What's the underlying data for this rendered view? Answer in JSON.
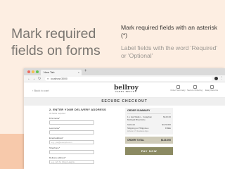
{
  "slide": {
    "headline": "Mark required fields on forms",
    "tip_required": "Mark required fields with an asterisk (*)",
    "tip_label": "Label fields with the word 'Required' or 'Optional'"
  },
  "browser": {
    "tab_title": "New Tab",
    "tab_close": "×",
    "new_tab": "+",
    "url": "localhost:3000/",
    "back": "←",
    "forward": "→",
    "reload": "↻",
    "menu": "⋮"
  },
  "site": {
    "back_link": "‹  Back to cart",
    "logo": "bellroy",
    "logo_sub": "CARRY BETTER",
    "header_items": [
      "Order Summary",
      "Secure Ordering",
      "Easy Returns"
    ],
    "page_title": "SECURE CHECKOUT"
  },
  "form": {
    "heading": "2. ENTER YOUR DELIVERY ADDRESS",
    "note": "All fields required",
    "fields": [
      {
        "label": "First name*",
        "placeholder": ""
      },
      {
        "label": "Last name*",
        "placeholder": ""
      },
      {
        "label": "Email address*",
        "placeholder": "e.g. you@example.com"
      },
      {
        "label": "Telephone*",
        "placeholder": ""
      },
      {
        "label": "Delivery address*",
        "placeholder": "e.g. 123 St. (Brgy) Heights"
      }
    ]
  },
  "summary": {
    "title": "ORDER SUMMARY",
    "item_name": "1 x Hat Wallet – Caraghan Midnight Blue/Ashe",
    "item_price": "$123.00",
    "subtotal_label": "Subtotal",
    "subtotal_value": "$123.000",
    "shipping_label": "Shipping to Philippines",
    "shipping_note": "Arrives in 5 business days",
    "shipping_value": "FREE",
    "total_label": "ORDER TOTAL",
    "total_value": "$123.000",
    "pay_button": "PAY NOW"
  }
}
